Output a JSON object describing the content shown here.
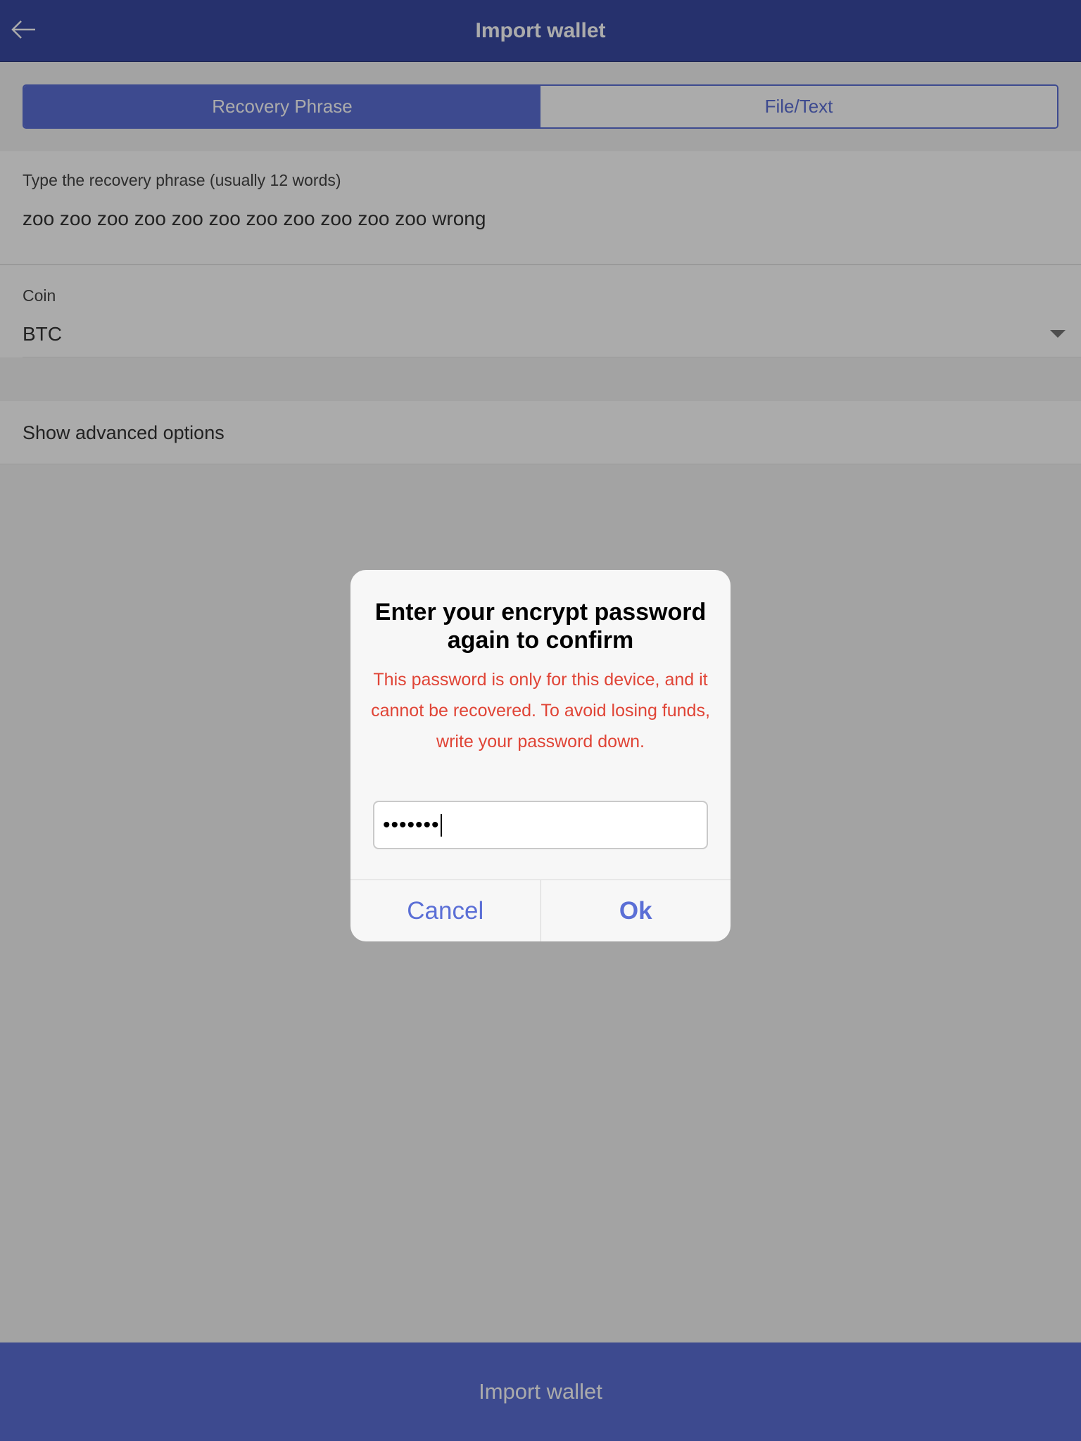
{
  "header": {
    "title": "Import wallet",
    "back_icon": "arrow-left-icon"
  },
  "tabs": [
    {
      "label": "Recovery Phrase",
      "active": true
    },
    {
      "label": "File/Text",
      "active": false
    }
  ],
  "phrase": {
    "label": "Type the recovery phrase (usually 12 words)",
    "value": "zoo zoo zoo zoo zoo zoo zoo zoo zoo zoo zoo wrong"
  },
  "coin": {
    "label": "Coin",
    "value": "BTC"
  },
  "advanced": {
    "label": "Show advanced options"
  },
  "footer": {
    "button_label": "Import wallet"
  },
  "dialog": {
    "title": "Enter your encrypt password again to confirm",
    "message": "This password is only for this device, and it cannot be recovered. To avoid losing funds, write your password down.",
    "password_mask": "•••••••",
    "cancel_label": "Cancel",
    "ok_label": "Ok"
  },
  "colors": {
    "header_bg": "#3a4aa3",
    "accent": "#5b6fd6",
    "warning": "#e04436"
  }
}
